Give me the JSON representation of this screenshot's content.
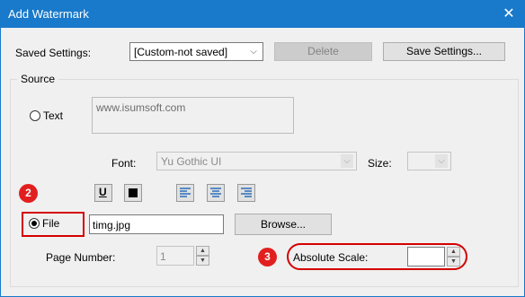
{
  "window": {
    "title": "Add Watermark",
    "close_glyph": "✕"
  },
  "saved_settings": {
    "label": "Saved Settings:",
    "selected": "[Custom-not saved]",
    "delete_label": "Delete",
    "save_label": "Save Settings..."
  },
  "source": {
    "title": "Source",
    "text_option": "Text",
    "text_value": "www.isumsoft.com",
    "font_label": "Font:",
    "font_value": "Yu Gothic UI",
    "size_label": "Size:",
    "size_value": "",
    "file_option": "File",
    "file_value": "timg.jpg",
    "browse_label": "Browse...",
    "page_number_label": "Page Number:",
    "page_number_value": "1",
    "absolute_scale_label": "Absolute Scale:",
    "absolute_scale_value": ""
  },
  "format_buttons": [
    "underline-icon",
    "color-swatch-icon",
    "align-left-icon",
    "align-center-icon",
    "align-right-icon"
  ],
  "callouts": [
    "2",
    "3"
  ],
  "colors": {
    "titlebar": "#1979ca",
    "callout": "#e21f1f",
    "highlight": "#d40000"
  }
}
